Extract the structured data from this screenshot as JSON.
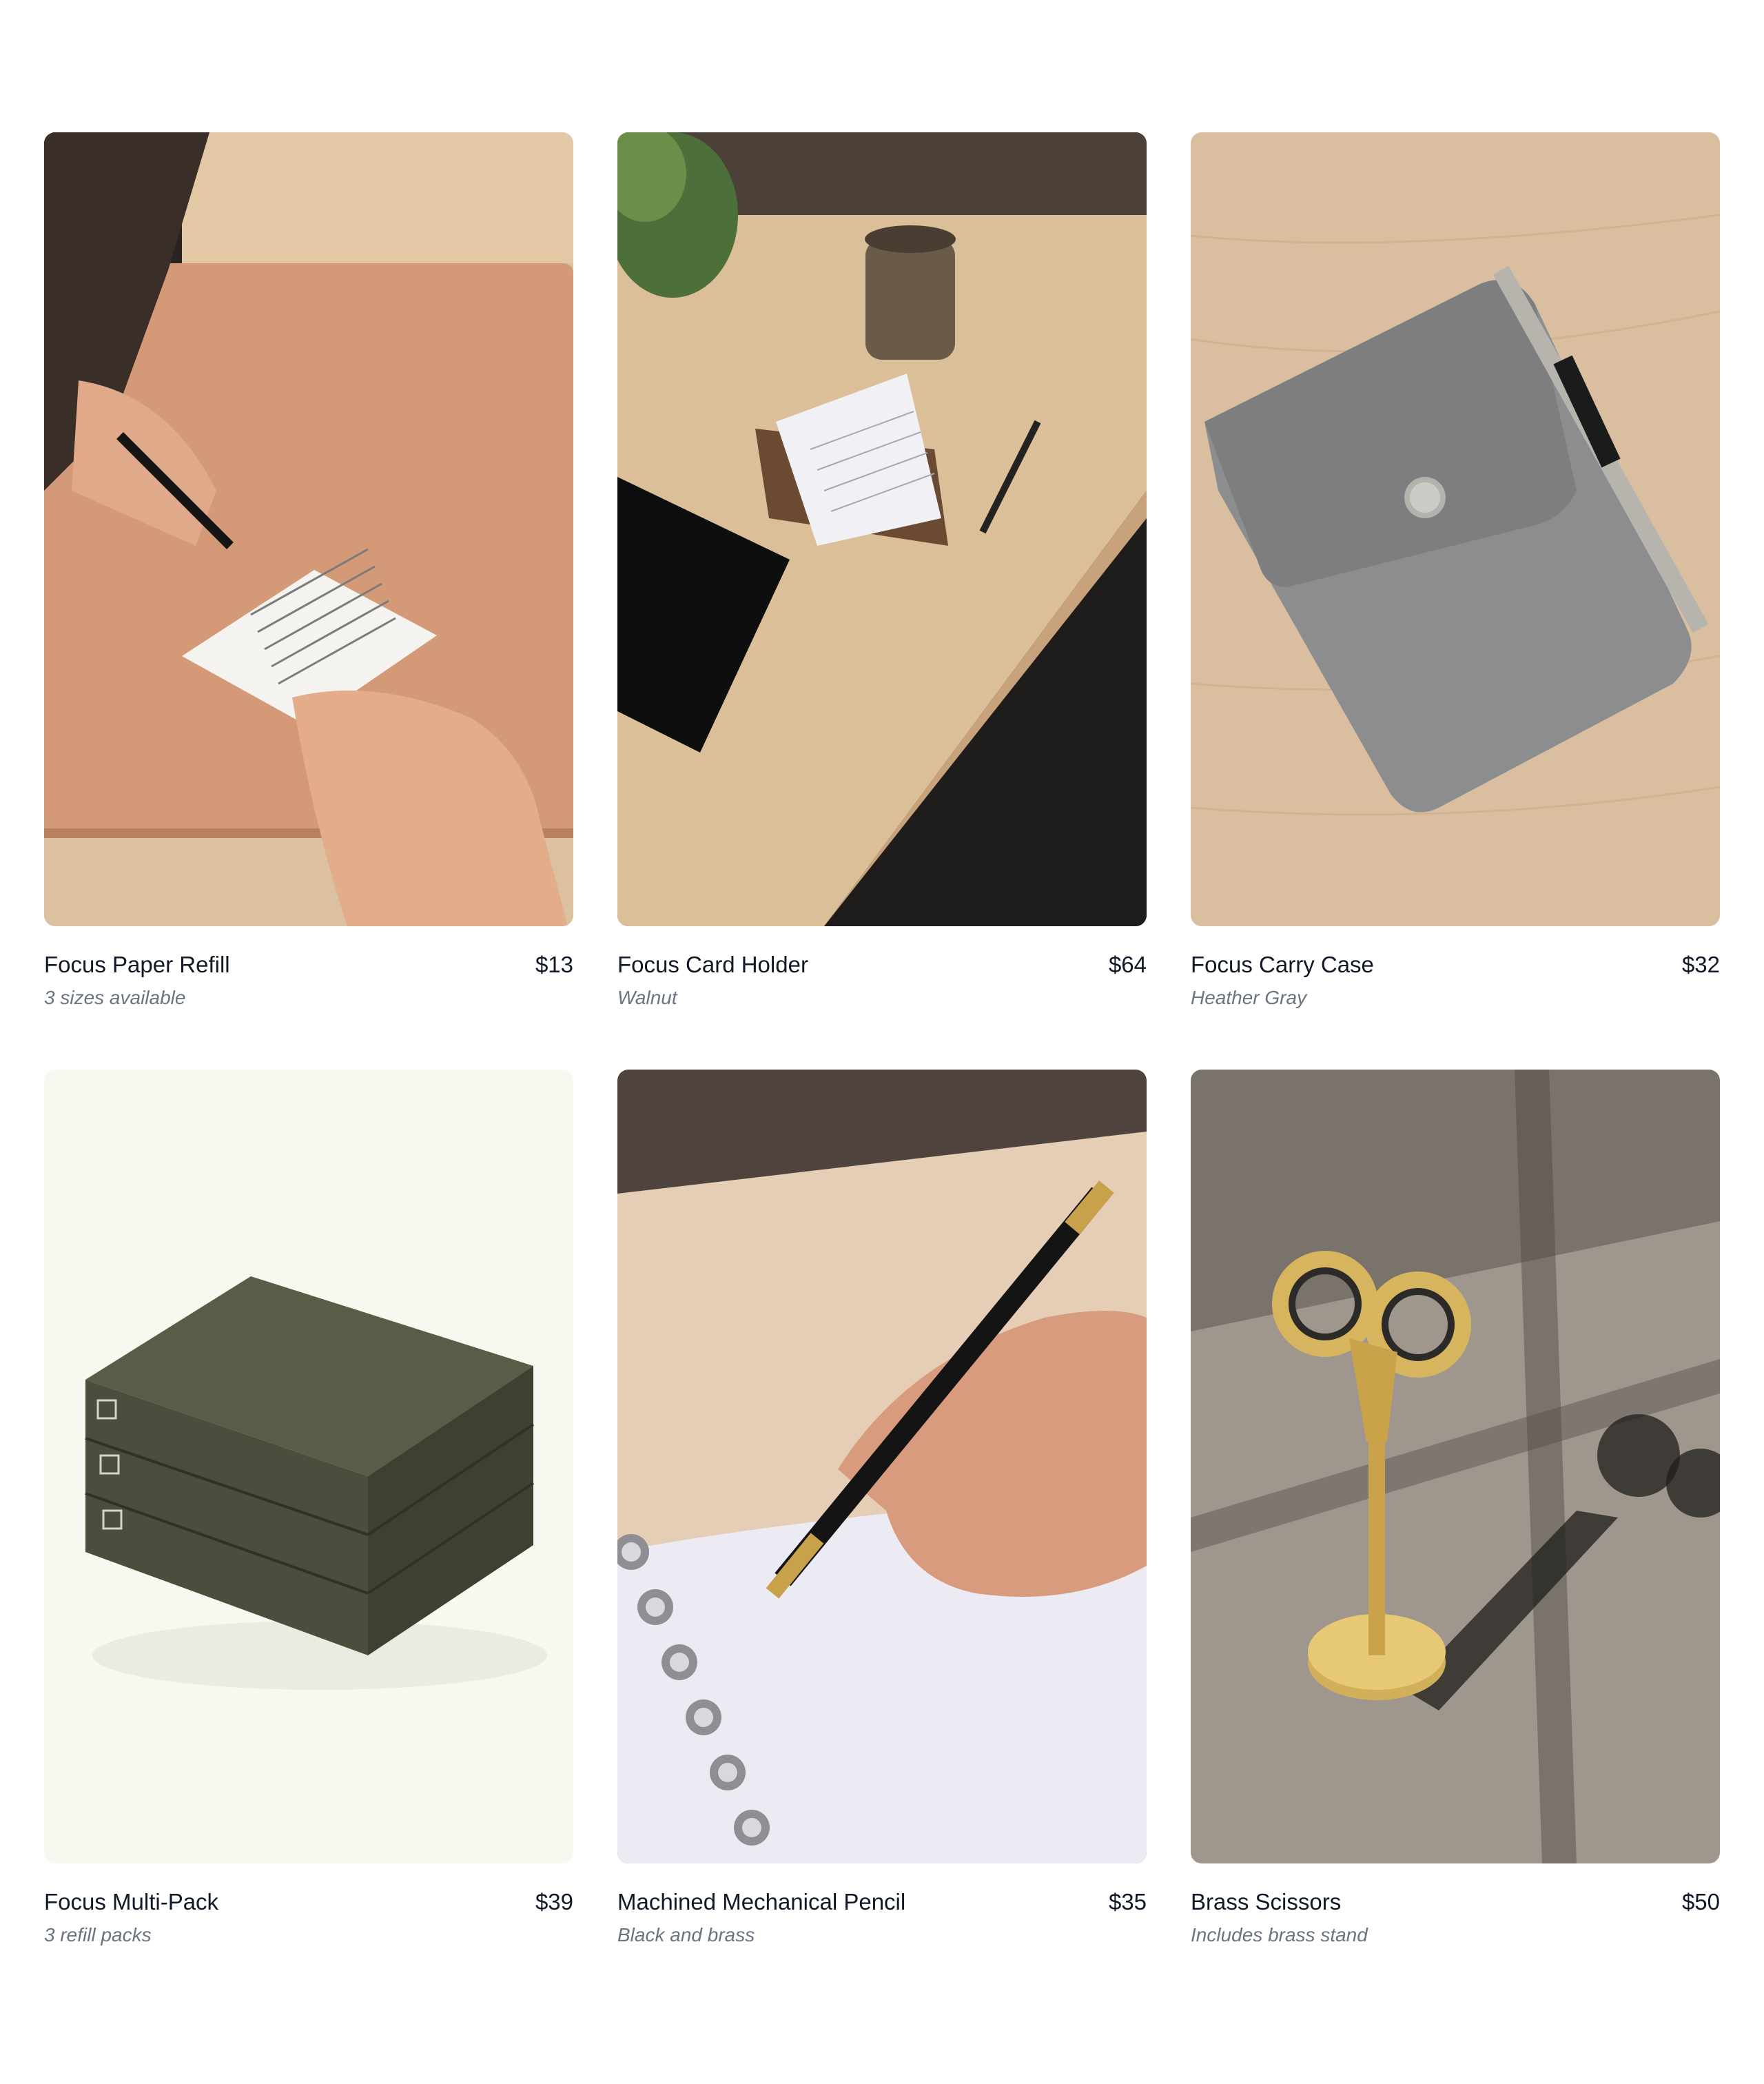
{
  "products": [
    {
      "name": "Focus Paper Refill",
      "price": "$13",
      "subtitle": "3 sizes available",
      "image": "hand-writing-on-card-over-leather-desk-pad"
    },
    {
      "name": "Focus Card Holder",
      "price": "$64",
      "subtitle": "Walnut",
      "image": "walnut-card-holder-on-wood-desk"
    },
    {
      "name": "Focus Carry Case",
      "price": "$32",
      "subtitle": "Heather Gray",
      "image": "gray-felt-case-with-pen"
    },
    {
      "name": "Focus Multi-Pack",
      "price": "$39",
      "subtitle": "3 refill packs",
      "image": "stacked-green-boxes"
    },
    {
      "name": "Machined Mechanical Pencil",
      "price": "$35",
      "subtitle": "Black and brass",
      "image": "hand-writing-with-black-pencil-in-notebook"
    },
    {
      "name": "Brass Scissors",
      "price": "$50",
      "subtitle": "Includes brass stand",
      "image": "brass-scissors-on-stand"
    }
  ],
  "colors": {
    "text_primary": "#111827",
    "text_secondary": "#6b7280",
    "background": "#ffffff"
  }
}
